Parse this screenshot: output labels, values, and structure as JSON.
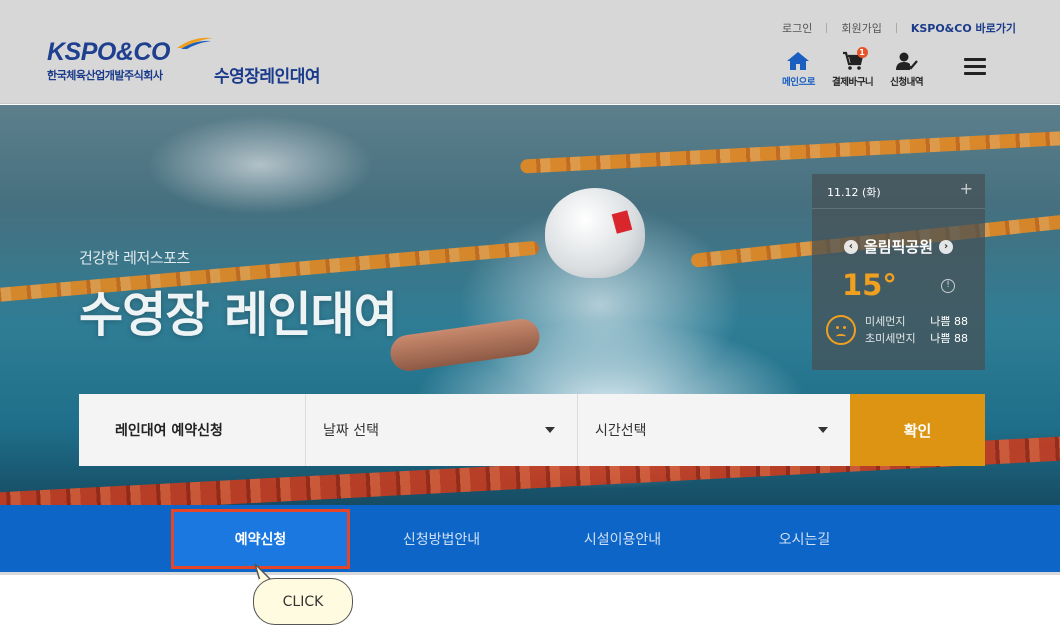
{
  "header": {
    "logo_text": "KSPO&CO",
    "logo_sub": "한국체육산업개발주식회사",
    "service_title": "수영장레인대여",
    "util_links": [
      "로그인",
      "회원가입",
      "KSPO&CO 바로가기"
    ],
    "quick": [
      {
        "label": "메인으로",
        "icon": "home-icon"
      },
      {
        "label": "결제바구니",
        "icon": "cart-icon",
        "badge": "1"
      },
      {
        "label": "신청내역",
        "icon": "user-check-icon"
      }
    ],
    "menu_icon": "hamburger-icon"
  },
  "hero": {
    "subtitle": "건강한 레저스포츠",
    "title": "수영장 레인대여"
  },
  "weather": {
    "date": "11.12 (화)",
    "plus": "+",
    "location": "올림픽공원",
    "prev": "‹",
    "next": "›",
    "temperature": "15°",
    "info": "!",
    "dust_label": "미세먼지",
    "dust_value": "나쁨 88",
    "ultra_label": "초미세먼지",
    "ultra_value": "나쁨 88"
  },
  "reservation": {
    "label": "레인대여 예약신청",
    "date_select": "날짜 선택",
    "time_select": "시간선택",
    "confirm": "확인"
  },
  "nav": {
    "items": [
      "예약신청",
      "신청방법안내",
      "시설이용안내",
      "오시는길"
    ]
  },
  "callout": {
    "text": "CLICK"
  },
  "colors": {
    "brand_blue": "#1a3a8a",
    "nav_blue": "#0e65c8",
    "accent_orange": "#dd9412",
    "highlight_red": "#e5462a"
  }
}
